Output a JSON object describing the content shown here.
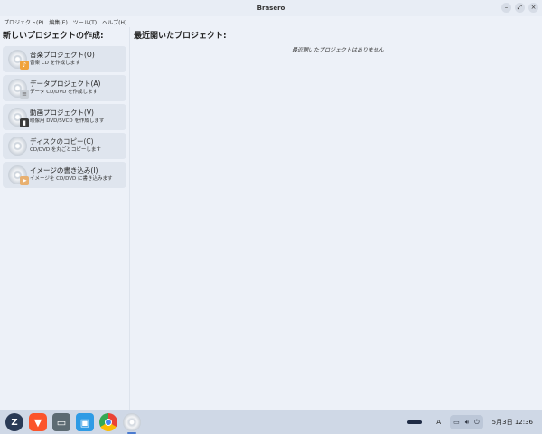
{
  "window": {
    "title": "Brasero"
  },
  "window_controls": {
    "minimize": "–",
    "maximize": "⤢",
    "close": "×"
  },
  "menubar": [
    "プロジェクト(P)",
    "編集(E)",
    "ツール(T)",
    "ヘルプ(H)"
  ],
  "left_pane": {
    "heading": "新しいプロジェクトの作成:",
    "projects": [
      {
        "title": "音楽プロジェクト(O)",
        "desc": "音楽 CD を作成します",
        "icon": "music-disc-icon"
      },
      {
        "title": "データプロジェクト(A)",
        "desc": "データ CD/DVD を作成します",
        "icon": "data-disc-icon"
      },
      {
        "title": "動画プロジェクト(V)",
        "desc": "映像用 DVD/SVCD を作成します",
        "icon": "video-disc-icon"
      },
      {
        "title": "ディスクのコピー(C)",
        "desc": "CD/DVD を丸ごとコピーします",
        "icon": "copy-disc-icon"
      },
      {
        "title": "イメージの書き込み(I)",
        "desc": "イメージを CD/DVD に書き込みます",
        "icon": "image-burn-icon"
      }
    ]
  },
  "right_pane": {
    "heading": "最近開いたプロジェクト:",
    "empty_message": "最近開いたプロジェクトはありません"
  },
  "taskbar": {
    "apps": [
      "zorin-menu-icon",
      "brave-browser-icon",
      "files-icon",
      "software-store-icon",
      "chrome-icon",
      "brasero-icon"
    ],
    "input_method": "A",
    "date": "5月3日",
    "time": "12:36"
  }
}
